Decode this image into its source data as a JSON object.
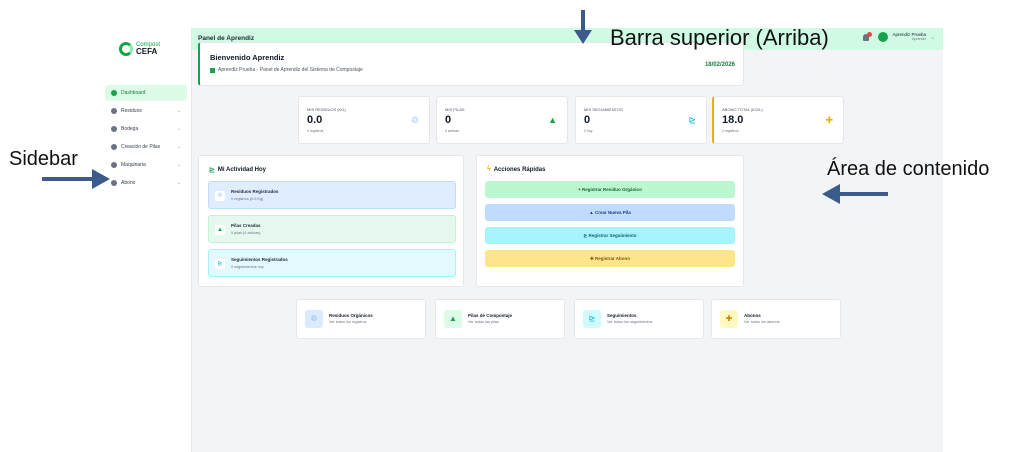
{
  "app": {
    "logo": {
      "top": "Compost",
      "bottom": "CEFA"
    },
    "topbar": {
      "title": "Panel de Aprendiz",
      "user_name": "Aprendiz Prueba",
      "user_role": "Aprendiz"
    },
    "sidebar": {
      "items": [
        {
          "label": "Dashboard",
          "icon": "dashboard-icon",
          "active": true
        },
        {
          "label": "Residuos",
          "icon": "recycle-icon",
          "caret": "⌄"
        },
        {
          "label": "Bodega",
          "icon": "warehouse-icon",
          "caret": "⌄"
        },
        {
          "label": "Creación de Pilas",
          "icon": "pile-icon",
          "caret": "⌄"
        },
        {
          "label": "Maquinaria",
          "icon": "machinery-icon",
          "caret": "⌄"
        },
        {
          "label": "Abono",
          "icon": "sprout-icon",
          "caret": "⌄"
        }
      ]
    },
    "welcome": {
      "title": "Bienvenido Aprendiz",
      "subtitle": "Aprendiz Prueba - Panel de Aprendiz del Sistema de Compostaje",
      "date": "18/02/2026"
    },
    "stats": [
      {
        "label": "MIS RESIDUOS (KG)",
        "value": "0.0",
        "sub": "0 registros",
        "icon": "recycle-icon",
        "color": "#3b82f6"
      },
      {
        "label": "MIS PILAS",
        "value": "0",
        "sub": "0 activas",
        "icon": "pile-icon",
        "color": "#16a34a"
      },
      {
        "label": "MIS SEGUIMIENTOS",
        "value": "0",
        "sub": "0 hoy",
        "icon": "chart-icon",
        "color": "#06b6d4"
      },
      {
        "label": "ABONO TOTAL (KG/L)",
        "value": "18.0",
        "sub": "2 registros",
        "icon": "sprout-icon",
        "color": "#eab308"
      }
    ],
    "activity": {
      "title": "Mi Actividad Hoy",
      "items": [
        {
          "title": "Residuos Registrados",
          "sub": "0 registros (0.0 Kg)"
        },
        {
          "title": "Pilas Creadas",
          "sub": "0 pilas (0 activas)"
        },
        {
          "title": "Seguimientos Registrados",
          "sub": "0 seguimientos hoy"
        }
      ]
    },
    "quick": {
      "title": "Acciones Rápidas",
      "buttons": [
        {
          "label": "+ Registrar Residuo Orgánico"
        },
        {
          "label": "▲ Crear Nueva Pila"
        },
        {
          "label": "⊵ Registrar Seguimiento"
        },
        {
          "label": "✚ Registrar Abono"
        }
      ]
    },
    "modules": [
      {
        "title": "Residuos Orgánicos",
        "sub": "Ver todos los registros"
      },
      {
        "title": "Pilas de Compostaje",
        "sub": "Ver todas las pilas"
      },
      {
        "title": "Seguimientos",
        "sub": "Ver todos los seguimientos"
      },
      {
        "title": "Abonos",
        "sub": "Ver todos los abonos"
      }
    ]
  },
  "annotations": {
    "top": "Barra superior (Arriba)",
    "sidebar": "Sidebar",
    "content": "Área de contenido"
  }
}
